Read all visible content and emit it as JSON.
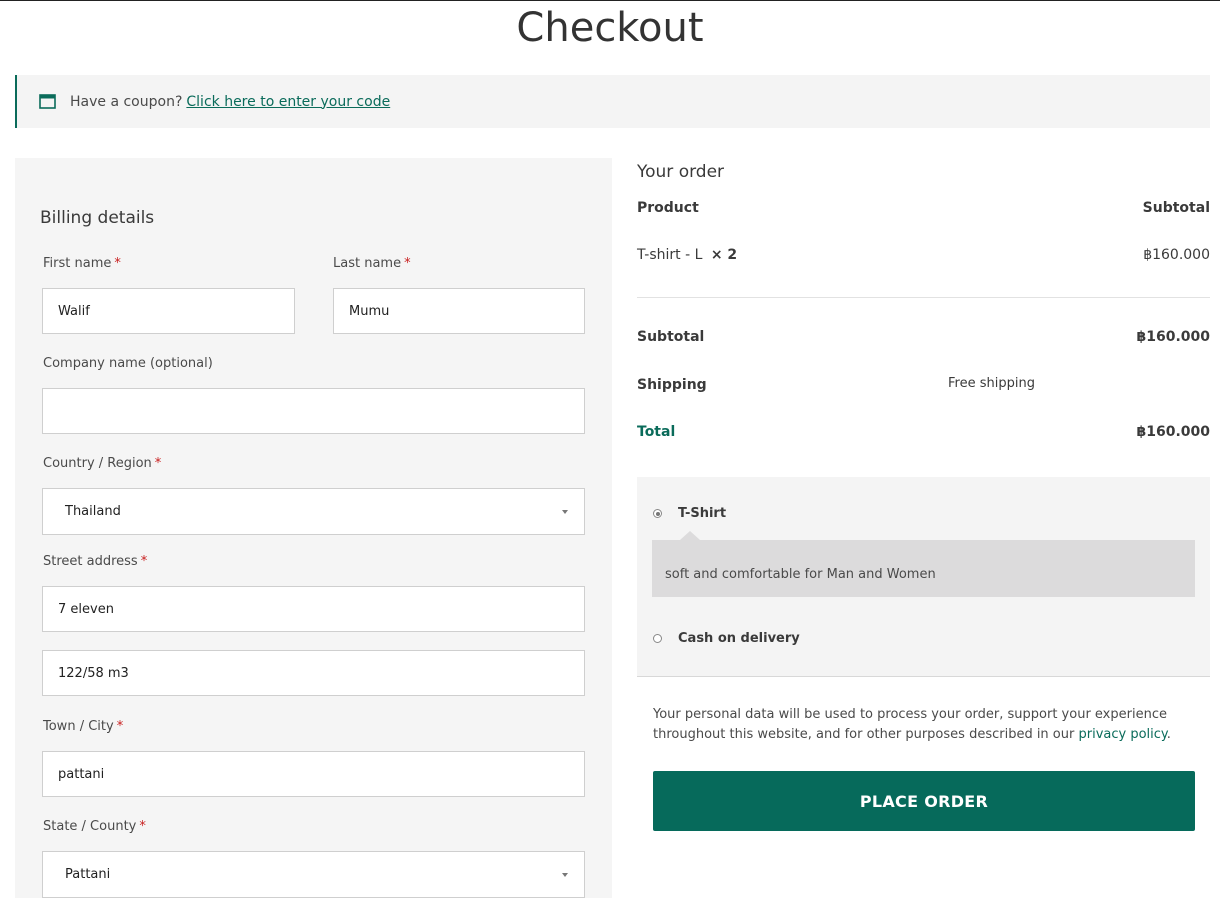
{
  "page": {
    "title": "Checkout"
  },
  "coupon": {
    "text": "Have a coupon?",
    "link": "Click here to enter your code",
    "icon": "calendar-icon"
  },
  "billing": {
    "heading": "Billing details",
    "required_mark": "*",
    "first_name": {
      "label": "First name",
      "value": "Walif"
    },
    "last_name": {
      "label": "Last name",
      "value": "Mumu"
    },
    "company": {
      "label": "Company name (optional)",
      "value": ""
    },
    "country": {
      "label": "Country / Region",
      "value": "Thailand"
    },
    "street": {
      "label": "Street address",
      "line1": "7 eleven",
      "line2": "122/58 m3"
    },
    "city": {
      "label": "Town / City",
      "value": "pattani"
    },
    "state": {
      "label": "State / County",
      "value": "Pattani"
    }
  },
  "order": {
    "heading": "Your order",
    "col_product": "Product",
    "col_subtotal": "Subtotal",
    "item": {
      "name": "T-shirt - L",
      "qty": "× 2",
      "price": "฿160.000"
    },
    "subtotal": {
      "label": "Subtotal",
      "value": "฿160.000"
    },
    "shipping": {
      "label": "Shipping",
      "value": "Free shipping"
    },
    "total": {
      "label": "Total",
      "value": "฿160.000"
    }
  },
  "payment": {
    "methods": [
      {
        "label": "T-Shirt",
        "description": "soft and comfortable for Man and Women",
        "selected": true
      },
      {
        "label": "Cash on delivery",
        "selected": false
      }
    ]
  },
  "privacy": {
    "text": "Your personal data will be used to process your order, support your experience throughout this website, and for other purposes described in our",
    "link": "privacy policy",
    "end": "."
  },
  "place_order_label": "PLACE ORDER",
  "colors": {
    "accent": "#066a5b",
    "required": "#c81d1d",
    "panel": "#f5f5f5"
  }
}
